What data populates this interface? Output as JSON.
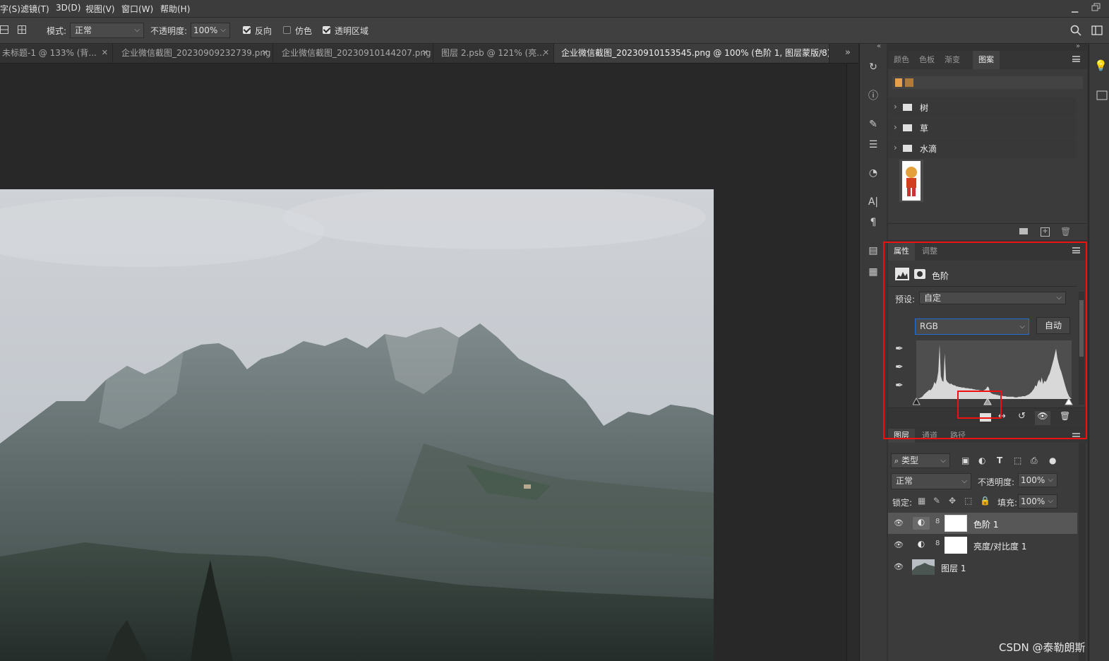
{
  "menu": [
    "字(S)",
    "滤镜(T)",
    "3D(D)",
    "视图(V)",
    "窗口(W)",
    "帮助(H)"
  ],
  "options": {
    "mode_label": "模式:",
    "mode_value": "正常",
    "opacity_label": "不透明度:",
    "opacity_value": "100%",
    "reverse_label": "反向",
    "dither_label": "仿色",
    "transparency_label": "透明区域"
  },
  "tabs": [
    {
      "label": "未标题-1 @ 133% (背..."
    },
    {
      "label": "企业微信截图_20230909232739.png"
    },
    {
      "label": "企业微信截图_20230910144207.png"
    },
    {
      "label": "图层 2.psb @ 121% (亮..."
    },
    {
      "label": "企业微信截图_20230910153545.png @ 100% (色阶 1, 图层蒙版/8) *"
    }
  ],
  "swatch_panel": {
    "tabs": [
      "颜色",
      "色板",
      "渐变",
      "图案"
    ],
    "groups": [
      "树",
      "草",
      "水滴"
    ]
  },
  "properties": {
    "tabs": [
      "属性",
      "调整"
    ],
    "title": "色阶",
    "preset_label": "预设:",
    "preset_value": "自定",
    "channel": "RGB",
    "auto_label": "自动",
    "histogram": [
      0,
      0,
      1,
      2,
      3,
      5,
      8,
      10,
      12,
      14,
      16,
      15,
      18,
      22,
      30,
      26,
      34,
      48,
      95,
      40,
      32,
      30,
      80,
      34,
      30,
      28,
      26,
      27,
      25,
      24,
      24,
      22,
      22,
      21,
      21,
      20,
      20,
      20,
      19,
      19,
      19,
      18,
      18,
      18,
      17,
      17,
      16,
      16,
      16,
      15,
      15,
      14,
      15,
      16,
      18,
      22,
      20,
      12,
      10,
      9,
      8,
      8,
      7,
      7,
      6,
      6,
      6,
      5,
      5,
      5,
      4,
      4,
      4,
      4,
      4,
      4,
      3,
      3,
      3,
      4,
      4,
      4,
      5,
      5,
      5,
      6,
      7,
      8,
      10,
      12,
      15,
      18,
      24,
      22,
      30,
      34,
      28,
      38,
      26,
      32,
      30,
      34,
      40,
      44,
      52,
      60,
      68,
      78,
      88,
      72,
      62,
      54,
      48,
      40,
      32,
      24,
      16,
      10,
      5,
      2
    ]
  },
  "layers_panel": {
    "tabs": [
      "图层",
      "通道",
      "路径"
    ],
    "filter_label": "类型",
    "blend_mode": "正常",
    "opacity_label": "不透明度:",
    "opacity_value": "100%",
    "lock_label": "锁定:",
    "fill_label": "填充:",
    "fill_value": "100%",
    "layers": [
      {
        "name": "色阶 1"
      },
      {
        "name": "亮度/对比度 1"
      },
      {
        "name": "图层 1"
      }
    ]
  },
  "watermark": "CSDN @泰勒朗斯",
  "colors": {
    "accent": "#1f6fd6",
    "highlight": "#e11111"
  }
}
